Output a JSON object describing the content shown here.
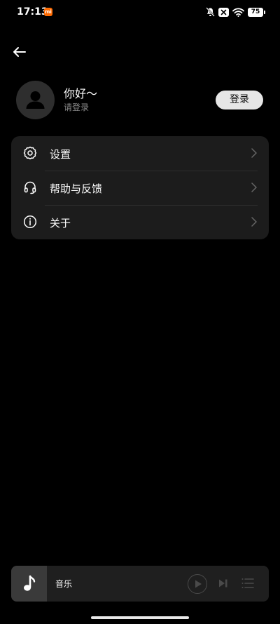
{
  "status_bar": {
    "time": "17:13",
    "mi_badge": "mi",
    "battery": "75"
  },
  "profile": {
    "greeting": "你好～",
    "login_hint": "请登录",
    "login_button": "登录"
  },
  "menu": {
    "items": [
      {
        "label": "设置",
        "icon": "gear-icon"
      },
      {
        "label": "帮助与反馈",
        "icon": "headset-icon"
      },
      {
        "label": "关于",
        "icon": "info-icon"
      }
    ]
  },
  "player": {
    "title": "音乐",
    "icon": "music-note-icon"
  },
  "colors": {
    "background": "#000000",
    "card": "#1c1c1c",
    "login_button_bg": "#e6e6e6",
    "mi_badge": "#ff6a00"
  }
}
